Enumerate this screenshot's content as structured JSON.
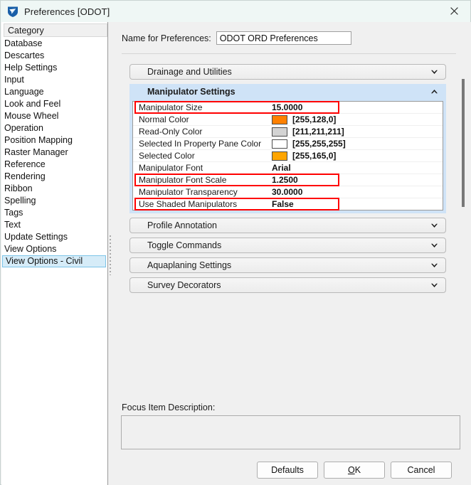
{
  "window": {
    "title": "Preferences [ODOT]",
    "icon": "bentley-shield-icon",
    "close_label": "✕"
  },
  "sidebar": {
    "header": "Category",
    "items": [
      {
        "label": "Database",
        "selected": false
      },
      {
        "label": "Descartes",
        "selected": false
      },
      {
        "label": "Help Settings",
        "selected": false
      },
      {
        "label": "Input",
        "selected": false
      },
      {
        "label": "Language",
        "selected": false
      },
      {
        "label": "Look and Feel",
        "selected": false
      },
      {
        "label": "Mouse Wheel",
        "selected": false
      },
      {
        "label": "Operation",
        "selected": false
      },
      {
        "label": "Position Mapping",
        "selected": false
      },
      {
        "label": "Raster Manager",
        "selected": false
      },
      {
        "label": "Reference",
        "selected": false
      },
      {
        "label": "Rendering",
        "selected": false
      },
      {
        "label": "Ribbon",
        "selected": false
      },
      {
        "label": "Spelling",
        "selected": false
      },
      {
        "label": "Tags",
        "selected": false
      },
      {
        "label": "Text",
        "selected": false
      },
      {
        "label": "Update Settings",
        "selected": false
      },
      {
        "label": "View Options",
        "selected": false
      },
      {
        "label": "View Options - Civil",
        "selected": true
      }
    ]
  },
  "main": {
    "name_label": "Name for Preferences:",
    "name_value": "ODOT ORD Preferences",
    "name_placeholder": "",
    "sections": [
      {
        "title": "Drainage and Utilities",
        "expanded": false
      },
      {
        "title": "Manipulator Settings",
        "expanded": true
      },
      {
        "title": "Profile Annotation",
        "expanded": false
      },
      {
        "title": "Toggle Commands",
        "expanded": false
      },
      {
        "title": "Aquaplaning Settings",
        "expanded": false
      },
      {
        "title": "Survey Decorators",
        "expanded": false
      }
    ],
    "manipulator_settings": [
      {
        "name": "Manipulator Size",
        "value": "15.0000",
        "swatch": null,
        "highlighted": true
      },
      {
        "name": "Normal Color",
        "value": "[255,128,0]",
        "swatch": "#ff8000",
        "highlighted": false
      },
      {
        "name": "Read-Only Color",
        "value": "[211,211,211]",
        "swatch": "#d3d3d3",
        "highlighted": false
      },
      {
        "name": "Selected In Property Pane Color",
        "value": "[255,255,255]",
        "swatch": "#ffffff",
        "highlighted": false
      },
      {
        "name": "Selected Color",
        "value": "[255,165,0]",
        "swatch": "#ffa500",
        "highlighted": false
      },
      {
        "name": "Manipulator Font",
        "value": "Arial",
        "swatch": null,
        "highlighted": false
      },
      {
        "name": "Manipulator Font Scale",
        "value": "1.2500",
        "swatch": null,
        "highlighted": true
      },
      {
        "name": "Manipulator Transparency",
        "value": "30.0000",
        "swatch": null,
        "highlighted": false
      },
      {
        "name": "Use Shaded Manipulators",
        "value": "False",
        "swatch": null,
        "highlighted": true
      }
    ],
    "focus_label": "Focus Item Description:",
    "focus_text": ""
  },
  "footer": {
    "defaults": "Defaults",
    "ok_prefix": "O",
    "ok_suffix": "K",
    "cancel": "Cancel"
  },
  "colors": {
    "highlight": "#ff0000",
    "section_open_bg": "#cfe3f7",
    "selection_bg": "#d6ecf8",
    "titlebar_bg": "#eff7f5"
  }
}
